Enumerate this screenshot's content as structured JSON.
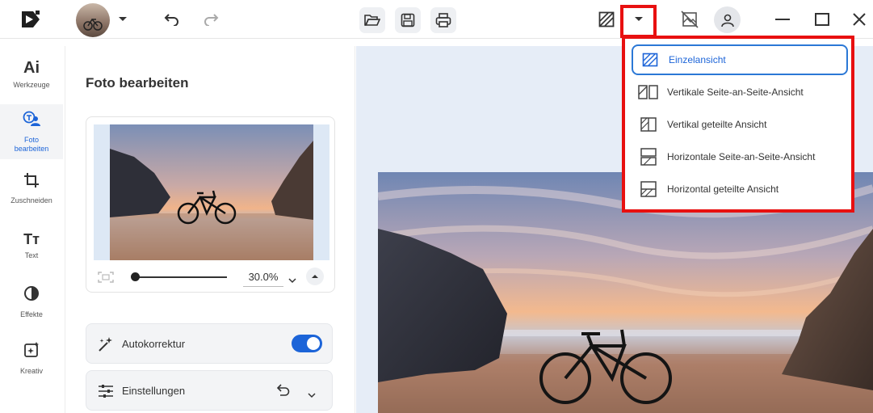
{
  "toolbar": {
    "icons": [
      "app-logo-icon",
      "avatar",
      "chevron-down-icon",
      "undo-icon",
      "redo-icon",
      "folder-open-icon",
      "save-icon",
      "print-icon",
      "view-mode-icon",
      "dropdown-arrow-icon",
      "compare-off-icon",
      "user-icon",
      "minimize-icon",
      "maximize-icon",
      "close-icon"
    ]
  },
  "rail": {
    "items": [
      {
        "label": "Werkzeuge",
        "glyph": "Ai"
      },
      {
        "label": "Foto bearbeiten"
      },
      {
        "label": "Zuschneiden"
      },
      {
        "label": "Text",
        "glyph": "Tт"
      },
      {
        "label": "Effekte"
      },
      {
        "label": "Kreativ"
      }
    ]
  },
  "panel": {
    "title": "Foto bearbeiten",
    "zoom": "30.0%",
    "zoom_slider_fraction": 0.0,
    "cards": [
      {
        "label": "Autokorrektur",
        "toggle_on": true
      },
      {
        "label": "Einstellungen"
      }
    ]
  },
  "view_menu": {
    "items": [
      {
        "label": "Einzelansicht",
        "selected": true
      },
      {
        "label": "Vertikale Seite-an-Seite-Ansicht"
      },
      {
        "label": "Vertikal geteilte Ansicht"
      },
      {
        "label": "Horizontale Seite-an-Seite-Ansicht"
      },
      {
        "label": "Horizontal geteilte Ansicht"
      }
    ]
  },
  "colors": {
    "accent": "#1c64d8",
    "highlight": "#e81010",
    "canvas_bg": "#e6edf7"
  }
}
